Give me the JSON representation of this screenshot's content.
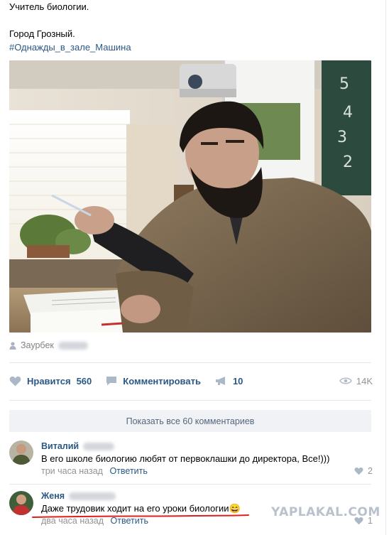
{
  "post": {
    "lines": [
      "Учитель биологии.",
      "",
      "Город Грозный."
    ],
    "hashtag": "#Однажды_в_зале_Машина",
    "author_first_name": "Заурбек"
  },
  "actions": {
    "like_label": "Нравится",
    "like_count": "560",
    "comment_label": "Комментировать",
    "share_count": "10",
    "views": "14K"
  },
  "comments_block": {
    "show_all_label": "Показать все 60 комментариев",
    "items": [
      {
        "name": "Виталий",
        "text": "В его школе биологию любят от первоклашки до директора, Все!)))",
        "time": "три часа назад",
        "reply_label": "Ответить",
        "likes": "2"
      },
      {
        "name": "Женя",
        "text": "Даже трудовик ходит на его уроки биологии",
        "emoji": "😄",
        "time": "два часа назад",
        "reply_label": "Ответить",
        "likes": "1"
      }
    ]
  },
  "watermark": "YAPLAKAL.COM",
  "colors": {
    "link": "#2a5885",
    "muted": "#939393",
    "divider": "#e7e8ec",
    "show_all_bg": "#f0f2f5",
    "underline": "#e02020"
  }
}
